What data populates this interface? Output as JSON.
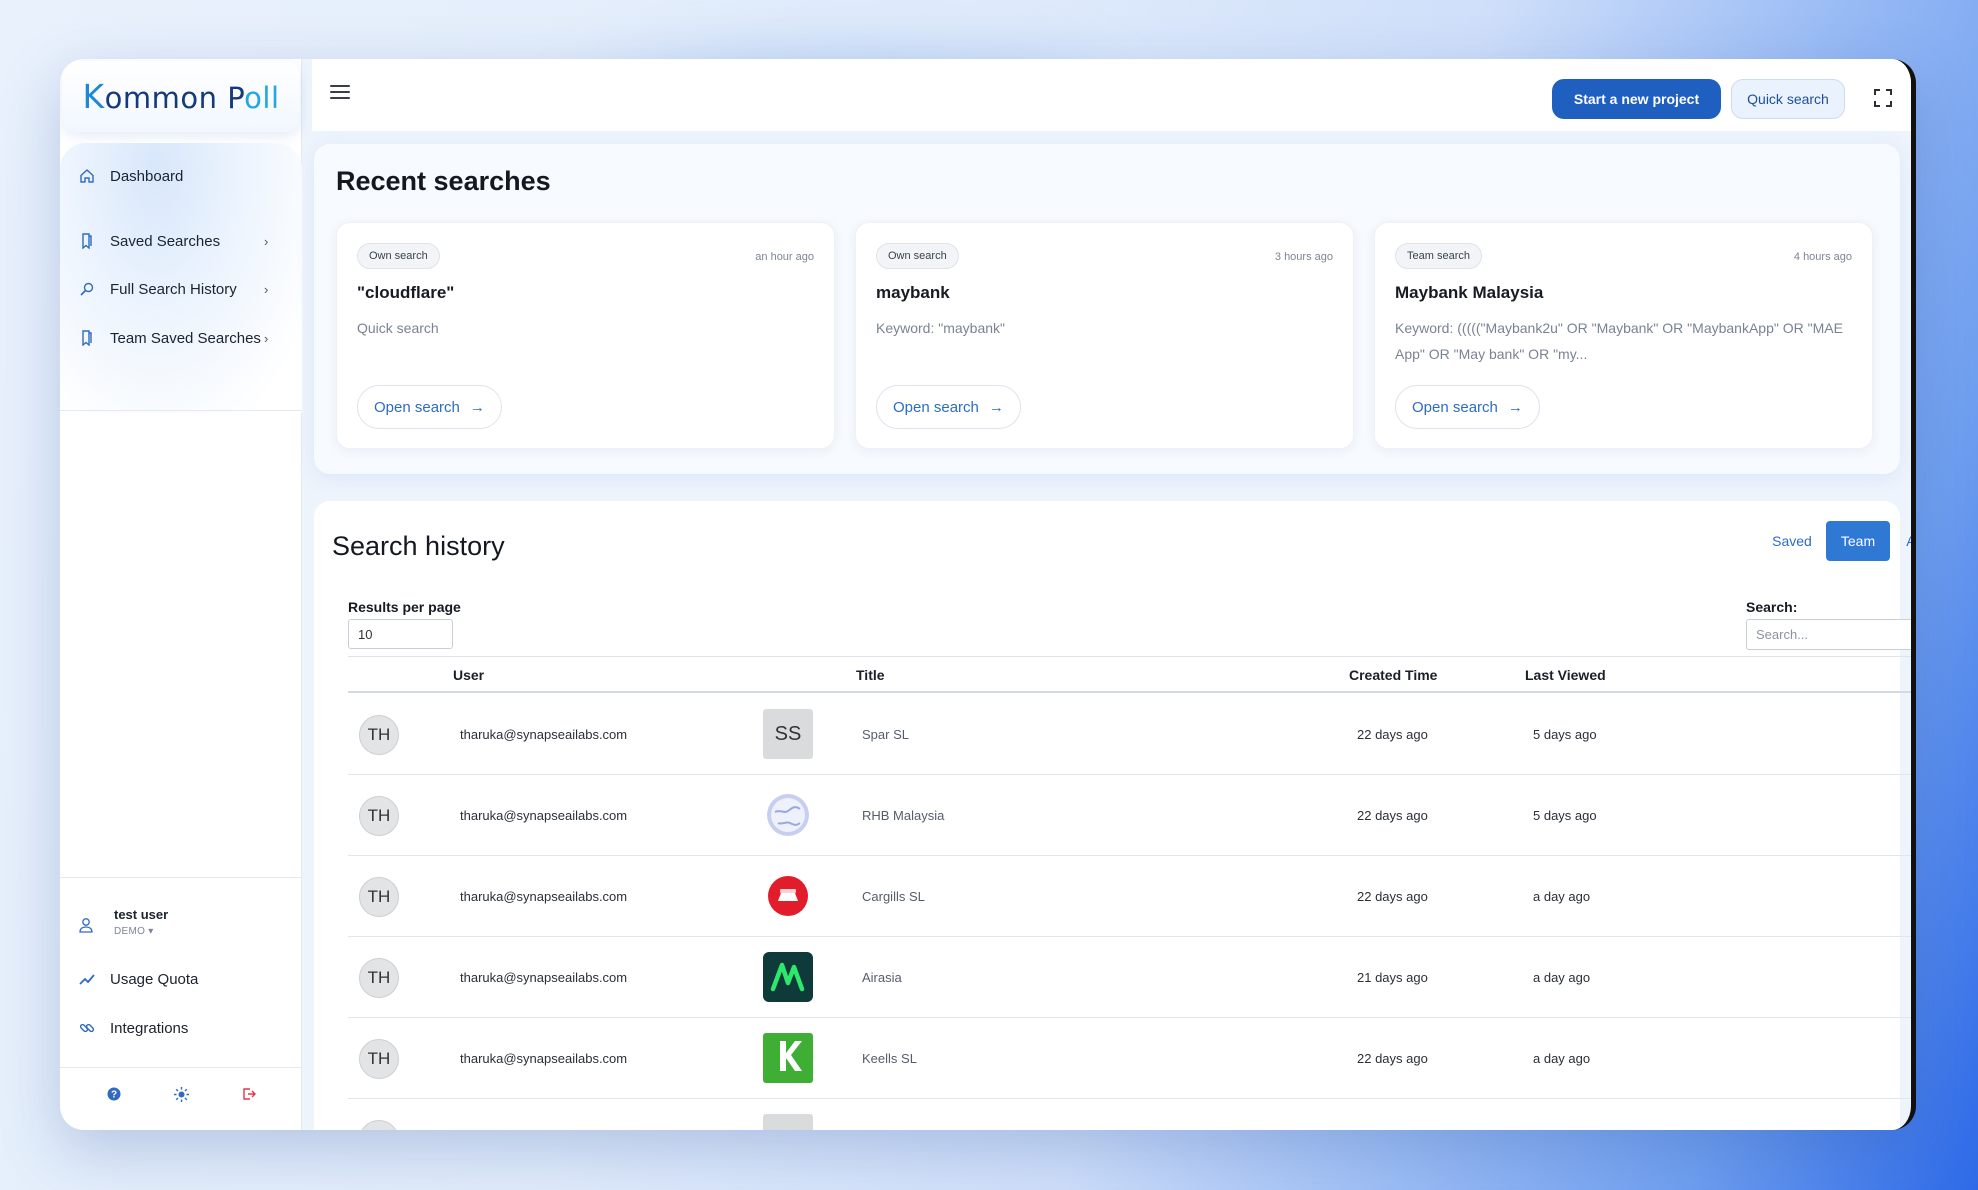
{
  "brand": {
    "logo_k": "K",
    "logo_mid": "ommon P",
    "logo_ll": "ll",
    "logo_mark": "o"
  },
  "sidebar": {
    "items": [
      {
        "label": "Dashboard",
        "icon": "home-icon"
      },
      {
        "label": "Saved Searches",
        "icon": "bookmark-icon"
      },
      {
        "label": "Full Search History",
        "icon": "search-icon"
      },
      {
        "label": "Team Saved Searches",
        "icon": "bookmark-icon"
      }
    ],
    "user": {
      "name": "test user",
      "role": "DEMO ▾"
    },
    "bottom_items": [
      {
        "label": "Usage Quota",
        "icon": "trend-icon"
      },
      {
        "label": "Integrations",
        "icon": "link-icon"
      }
    ],
    "footer_icons": [
      "help-icon",
      "theme-icon",
      "logout-icon"
    ]
  },
  "topbar": {
    "primary": "Start a new project",
    "secondary": "Quick search"
  },
  "recent": {
    "title": "Recent searches",
    "cards": [
      {
        "badge": "Own search",
        "when": "an hour ago",
        "title": "\"cloudflare\"",
        "desc": "Quick search",
        "button": "Open search",
        "arrow": "→"
      },
      {
        "badge": "Own search",
        "when": "3 hours ago",
        "title": "maybank",
        "desc": "Keyword: \"maybank\"",
        "button": "Open search",
        "arrow": "→"
      },
      {
        "badge": "Team search",
        "when": "4 hours ago",
        "title": "Maybank Malaysia",
        "desc": "Keyword: (((((\"Maybank2u\" OR \"Maybank\" OR \"MaybankApp\" OR \"MAE App\" OR \"May bank\" OR \"my...",
        "button": "Open search",
        "arrow": "→"
      }
    ]
  },
  "history": {
    "title": "Search history",
    "filters": {
      "saved": "Saved",
      "team": "Team",
      "all": "All"
    },
    "rpp_label": "Results per page",
    "rpp_value": "10",
    "search_label": "Search:",
    "search_placeholder": "Search...",
    "columns": {
      "user": "User",
      "title": "Title",
      "created": "Created Time",
      "viewed": "Last Viewed"
    },
    "rows": [
      {
        "avatar": "TH",
        "email": "tharuka@synapseailabs.com",
        "thumb": "SS",
        "title": "Spar SL",
        "created": "22 days ago",
        "viewed": "5 days ago"
      },
      {
        "avatar": "TH",
        "email": "tharuka@synapseailabs.com",
        "thumb": "",
        "title": "RHB Malaysia",
        "created": "22 days ago",
        "viewed": "5 days ago"
      },
      {
        "avatar": "TH",
        "email": "tharuka@synapseailabs.com",
        "thumb": "",
        "title": "Cargills SL",
        "created": "22 days ago",
        "viewed": "a day ago"
      },
      {
        "avatar": "TH",
        "email": "tharuka@synapseailabs.com",
        "thumb": "",
        "title": "Airasia",
        "created": "21 days ago",
        "viewed": "a day ago"
      },
      {
        "avatar": "TH",
        "email": "tharuka@synapseailabs.com",
        "thumb": "",
        "title": "Keells SL",
        "created": "22 days ago",
        "viewed": "a day ago"
      }
    ]
  },
  "colors": {
    "primary": "#1f5fc0",
    "accent": "#2f78d4",
    "link": "#2c6cc4"
  }
}
